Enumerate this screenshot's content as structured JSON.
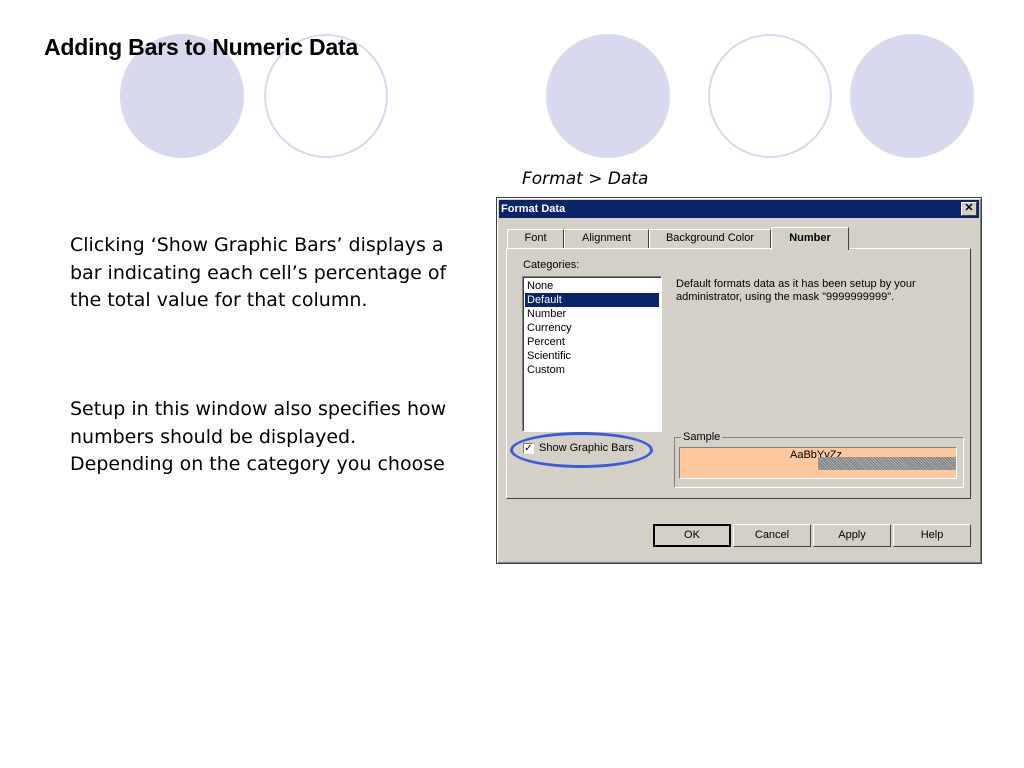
{
  "slide": {
    "title": "Adding Bars to Numeric Data",
    "paragraph1": "Clicking ‘Show Graphic Bars’ displays a bar indicating each cell’s percentage of the total value for that column.",
    "paragraph2": "Setup in this window also specifies how numbers should be displayed. Depending on the category you choose",
    "caption": "Format > Data",
    "circle_color": "#d8d8ee"
  },
  "dialog": {
    "title": "Format Data",
    "close_glyph": "✕",
    "tabs": [
      {
        "label": "Font"
      },
      {
        "label": "Alignment"
      },
      {
        "label": "Background Color"
      },
      {
        "label": "Number"
      }
    ],
    "active_tab": "Number",
    "categories_label": "Categories:",
    "categories": [
      "None",
      "Default",
      "Number",
      "Currency",
      "Percent",
      "Scientific",
      "Custom"
    ],
    "selected_category": "Default",
    "description": "Default formats data as it has been setup by your administrator, using the mask \"9999999999\".",
    "show_graphic_bars": {
      "label": "Show Graphic Bars",
      "checked": true,
      "check_glyph": "✓"
    },
    "sample": {
      "label": "Sample",
      "text": "AaBbYyZz",
      "background": "#fdc89b"
    },
    "buttons": {
      "ok": "OK",
      "cancel": "Cancel",
      "apply": "Apply",
      "help": "Help"
    },
    "highlight_color": "#3b5bdb",
    "titlebar_color": "#0a246a"
  }
}
